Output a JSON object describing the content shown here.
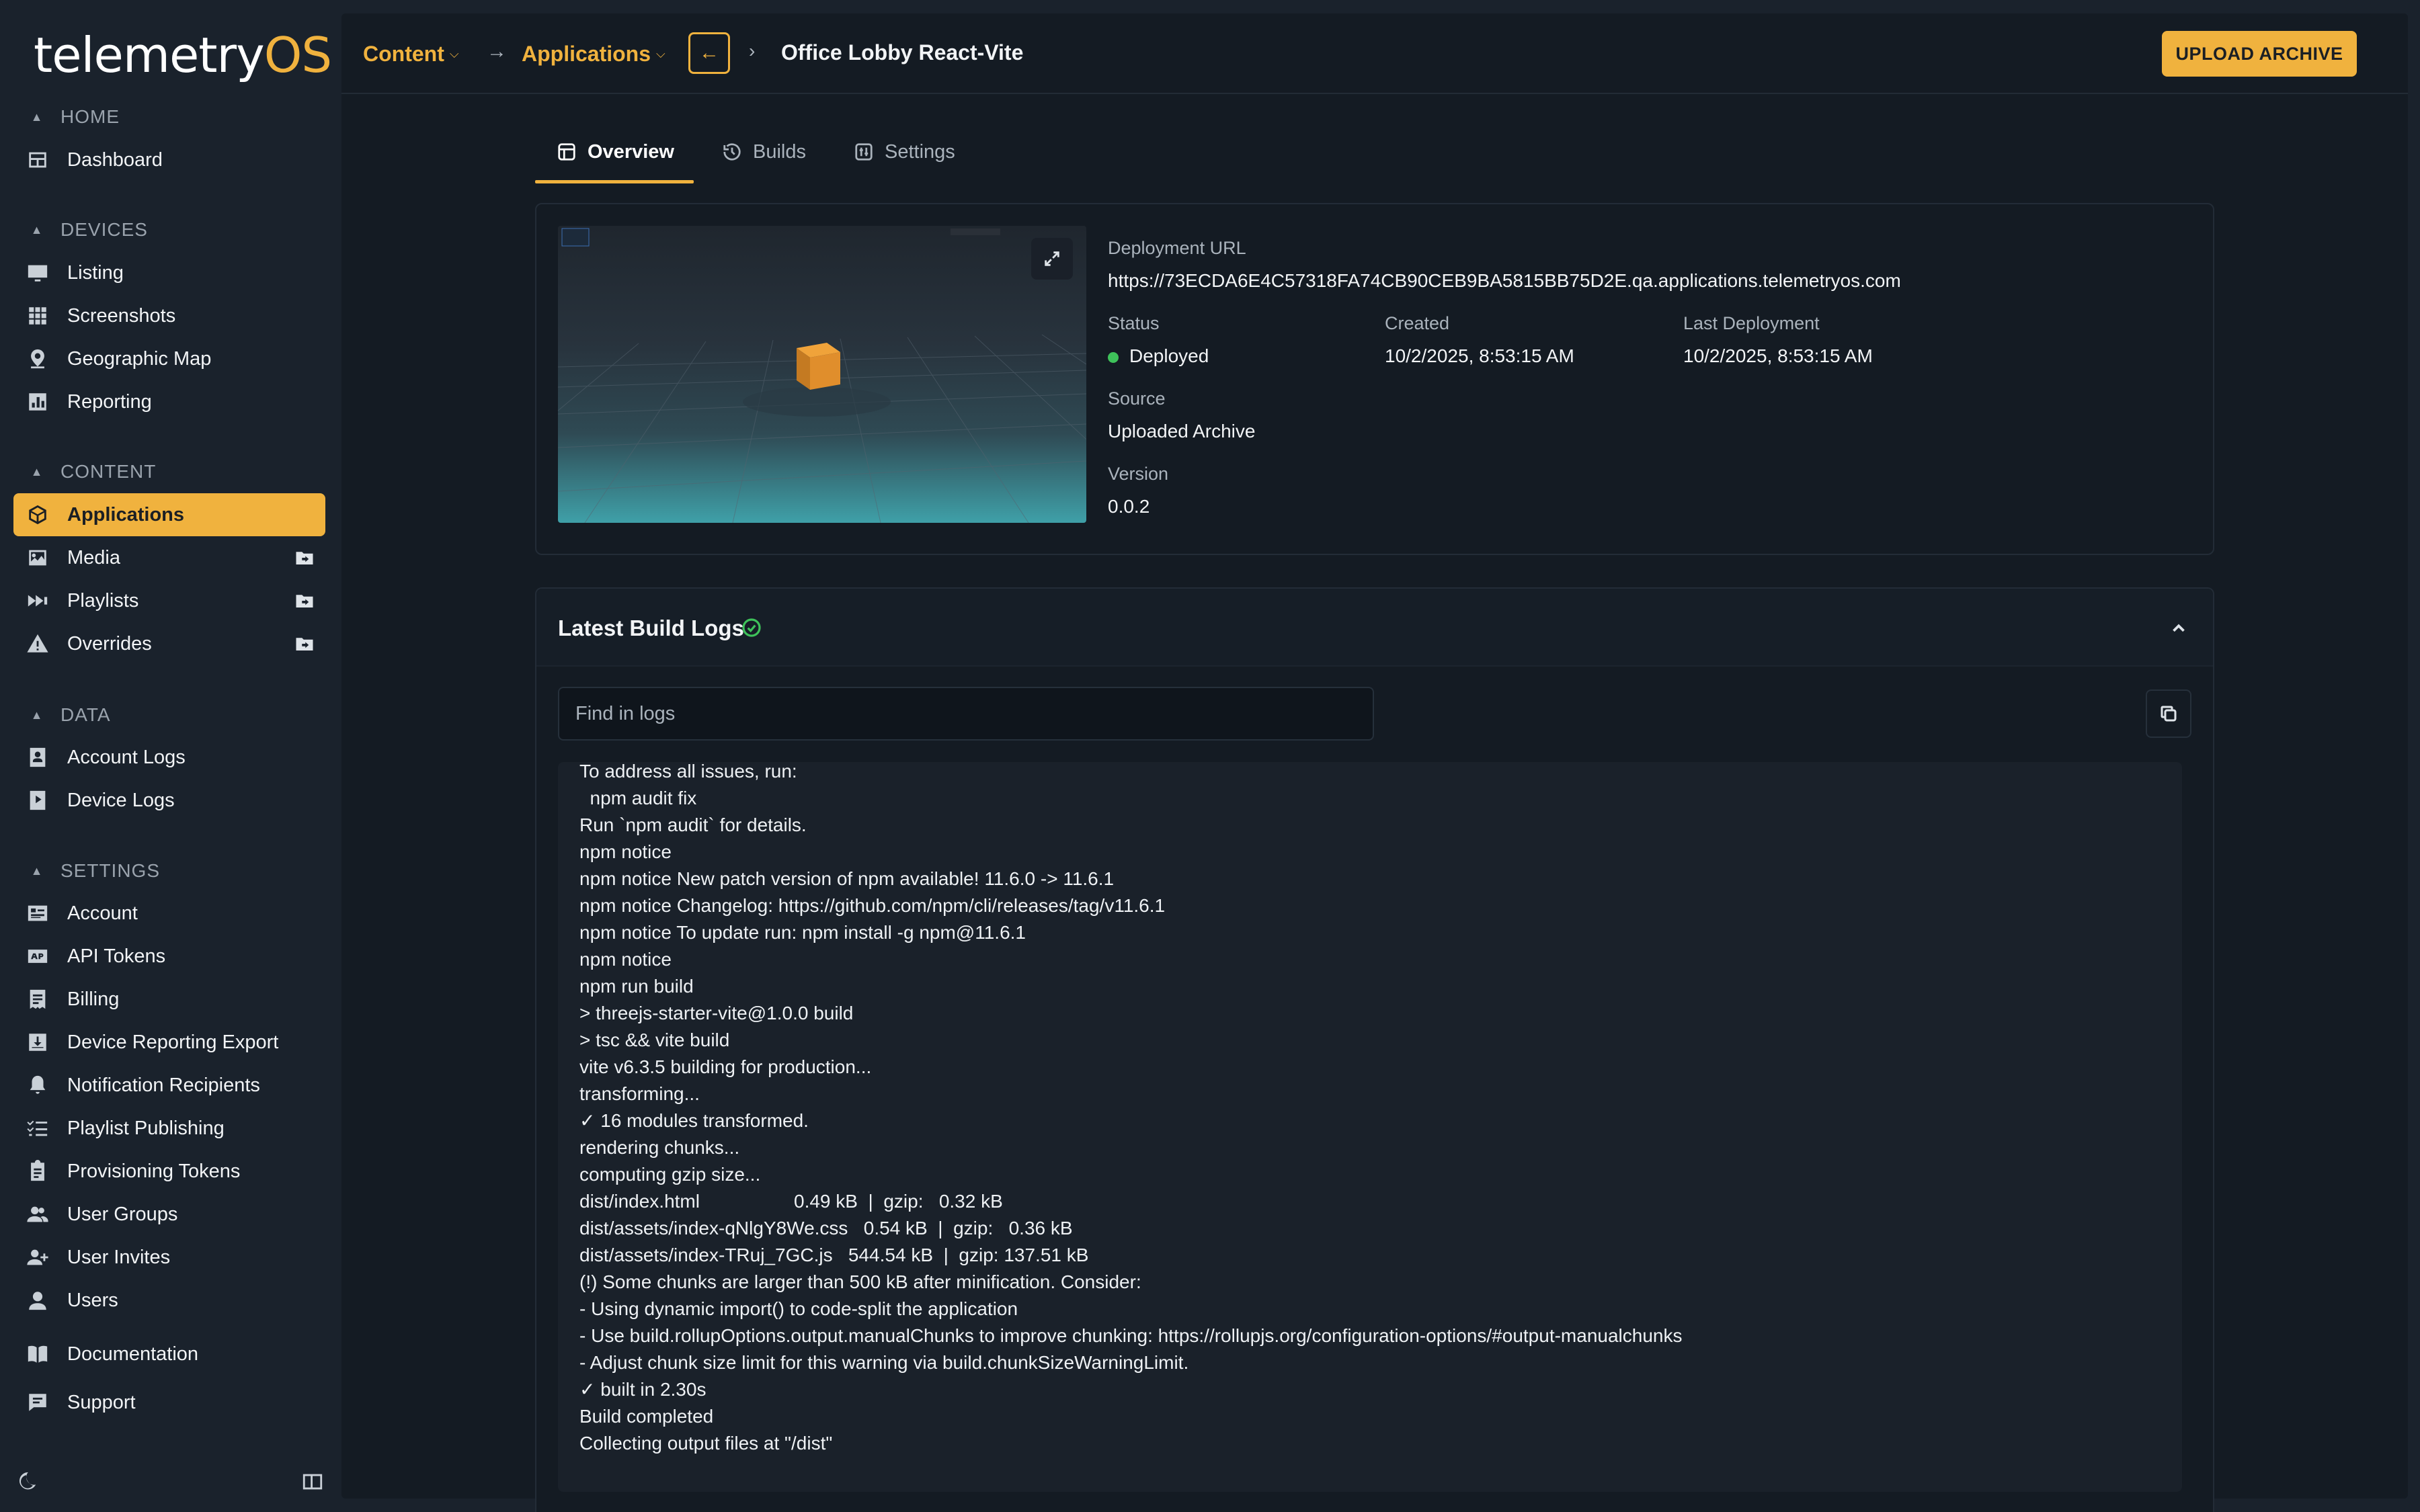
{
  "app": {
    "logo_main": "telemetry",
    "logo_accent": "OS"
  },
  "sidebar": {
    "sections": [
      {
        "label": "HOME"
      },
      {
        "label": "DEVICES"
      },
      {
        "label": "CONTENT"
      },
      {
        "label": "DATA"
      },
      {
        "label": "SETTINGS"
      }
    ],
    "items": {
      "dashboard": "Dashboard",
      "listing": "Listing",
      "screenshots": "Screenshots",
      "geographic_map": "Geographic Map",
      "reporting": "Reporting",
      "applications": "Applications",
      "media": "Media",
      "playlists": "Playlists",
      "overrides": "Overrides",
      "account_logs": "Account Logs",
      "device_logs": "Device Logs",
      "account": "Account",
      "api_tokens": "API Tokens",
      "billing": "Billing",
      "device_reporting_export": "Device Reporting Export",
      "notification_recipients": "Notification Recipients",
      "playlist_publishing": "Playlist Publishing",
      "provisioning_tokens": "Provisioning Tokens",
      "user_groups": "User Groups",
      "user_invites": "User Invites",
      "users": "Users",
      "documentation": "Documentation",
      "support": "Support"
    },
    "active_item": "Applications",
    "accent_color": "#f0b23e"
  },
  "header": {
    "breadcrumb": [
      "Content",
      "Applications"
    ],
    "title": "Office Lobby React-Vite",
    "upload_label": "UPLOAD ARCHIVE"
  },
  "tabs": [
    {
      "label": "Overview",
      "active": true
    },
    {
      "label": "Builds",
      "active": false
    },
    {
      "label": "Settings",
      "active": false
    }
  ],
  "overview": {
    "deployment_url_label": "Deployment URL",
    "deployment_url": "https://73ECDA6E4C57318FA74CB90CEB9BA5815BB75D2E.qa.applications.telemetryos.com",
    "status_label": "Status",
    "status": "Deployed",
    "status_color": "#3ec25a",
    "created_label": "Created",
    "created": "10/2/2025, 8:53:15 AM",
    "last_deployment_label": "Last Deployment",
    "last_deployment": "10/2/2025, 8:53:15 AM",
    "source_label": "Source",
    "source": "Uploaded Archive",
    "version_label": "Version",
    "version": "0.0.2"
  },
  "logs": {
    "title": "Latest Build Logs",
    "search_placeholder": "Find in logs",
    "lines": [
      "To address all issues, run:",
      "  npm audit fix",
      "Run `npm audit` for details.",
      "npm notice",
      "npm notice New patch version of npm available! 11.6.0 -> 11.6.1",
      "npm notice Changelog: https://github.com/npm/cli/releases/tag/v11.6.1",
      "npm notice To update run: npm install -g npm@11.6.1",
      "npm notice",
      "npm run build",
      "> threejs-starter-vite@1.0.0 build",
      "> tsc && vite build",
      "vite v6.3.5 building for production...",
      "transforming...",
      "✓ 16 modules transformed.",
      "rendering chunks...",
      "computing gzip size...",
      "dist/index.html                  0.49 kB  |  gzip:   0.32 kB",
      "dist/assets/index-qNlgY8We.css   0.54 kB  |  gzip:   0.36 kB",
      "dist/assets/index-TRuj_7GC.js   544.54 kB  |  gzip: 137.51 kB",
      "(!) Some chunks are larger than 500 kB after minification. Consider:",
      "- Using dynamic import() to code-split the application",
      "- Use build.rollupOptions.output.manualChunks to improve chunking: https://rollupjs.org/configuration-options/#output-manualchunks",
      "- Adjust chunk size limit for this warning via build.chunkSizeWarningLimit.",
      "✓ built in 2.30s",
      "Build completed",
      "Collecting output files at \"/dist\""
    ]
  }
}
